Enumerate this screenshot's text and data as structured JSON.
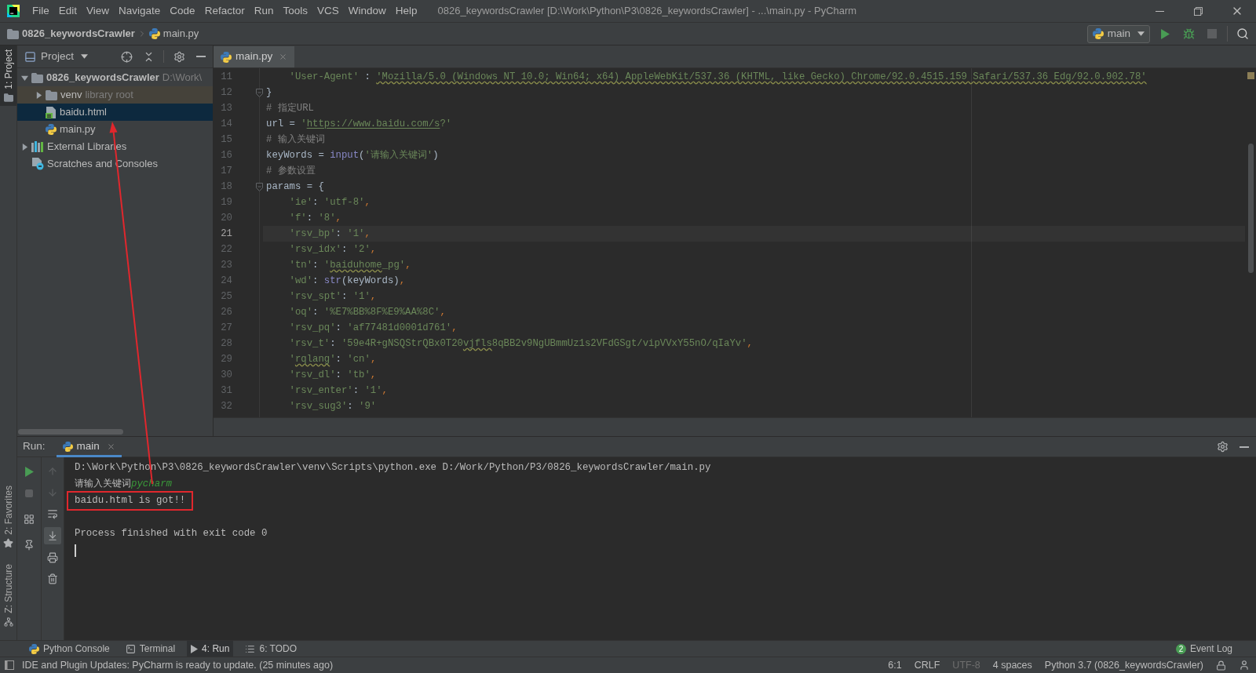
{
  "window": {
    "title": "0826_keywordsCrawler [D:\\Work\\Python\\P3\\0826_keywordsCrawler] - ...\\main.py - PyCharm"
  },
  "menu": [
    "File",
    "Edit",
    "View",
    "Navigate",
    "Code",
    "Refactor",
    "Run",
    "Tools",
    "VCS",
    "Window",
    "Help"
  ],
  "navigation": {
    "breadcrumb": [
      {
        "label": "0826_keywordsCrawler",
        "kind": "project"
      },
      {
        "label": "main.py",
        "kind": "python"
      }
    ],
    "run_config": "main",
    "stop_disabled": true
  },
  "side_stripe": [
    {
      "label": "1: Project",
      "kind": "folder",
      "selected": true
    },
    {
      "label": "2: Favorites",
      "kind": "star",
      "selected": false
    },
    {
      "label": "Z: Structure",
      "kind": "structure",
      "selected": false
    }
  ],
  "project": {
    "title": "Project",
    "tree": [
      {
        "label": "0826_keywordsCrawler",
        "hint": "D:\\Work\\",
        "kind": "project",
        "expanded": true,
        "selected": false,
        "children": [
          {
            "label": "venv",
            "hint": "library root",
            "kind": "venv",
            "expanded": false,
            "selected": false
          },
          {
            "label": "baidu.html",
            "kind": "html",
            "selected": true
          },
          {
            "label": "main.py",
            "kind": "python",
            "selected": false
          }
        ]
      },
      {
        "label": "External Libraries",
        "kind": "libraries",
        "expanded": false,
        "selected": false
      },
      {
        "label": "Scratches and Consoles",
        "kind": "scratches",
        "selected": false
      }
    ]
  },
  "editor": {
    "tabs": [
      {
        "label": "main.py",
        "selected": true
      }
    ],
    "lines": [
      {
        "number": "11",
        "current": false,
        "fold": false,
        "tokens": [
          {
            "kind": "string",
            "text": "    'User-Agent'"
          },
          {
            "kind": "plain",
            "text": " : "
          },
          {
            "kind": "flagged",
            "text": "'Mozilla/5.0 (Windows NT 10.0; Win64; x64) AppleWebKit/537.36 (KHTML, like Gecko) Chrome/92.0.4515.159 Safari/537.36 Edg/92.0.902.78'"
          }
        ]
      },
      {
        "number": "12",
        "current": false,
        "fold": true,
        "tokens": [
          {
            "kind": "plain",
            "text": "}"
          }
        ]
      },
      {
        "number": "13",
        "current": false,
        "fold": false,
        "tokens": [
          {
            "kind": "comment",
            "text": "# 指定URL"
          }
        ]
      },
      {
        "number": "14",
        "current": false,
        "fold": false,
        "tokens": [
          {
            "kind": "plain",
            "text": "url = "
          },
          {
            "kind": "string",
            "text": "'"
          },
          {
            "kind": "link",
            "text": "https://www.baidu.com/s"
          },
          {
            "kind": "string",
            "text": "?'"
          }
        ]
      },
      {
        "number": "15",
        "current": false,
        "fold": false,
        "tokens": [
          {
            "kind": "comment",
            "text": "# 输入关键词"
          }
        ]
      },
      {
        "number": "16",
        "current": false,
        "fold": false,
        "tokens": [
          {
            "kind": "plain",
            "text": "keyWords = "
          },
          {
            "kind": "builtin",
            "text": "input"
          },
          {
            "kind": "plain",
            "text": "("
          },
          {
            "kind": "string",
            "text": "'请输入关键词'"
          },
          {
            "kind": "plain",
            "text": ")"
          }
        ]
      },
      {
        "number": "17",
        "current": false,
        "fold": false,
        "tokens": [
          {
            "kind": "comment",
            "text": "# 参数设置"
          }
        ]
      },
      {
        "number": "18",
        "current": false,
        "fold": true,
        "tokens": [
          {
            "kind": "plain",
            "text": "params = {"
          }
        ]
      },
      {
        "number": "19",
        "current": false,
        "fold": false,
        "tokens": [
          {
            "kind": "string",
            "text": "    'ie'"
          },
          {
            "kind": "plain",
            "text": ": "
          },
          {
            "kind": "string",
            "text": "'utf-8'"
          },
          {
            "kind": "punct",
            "text": ","
          }
        ]
      },
      {
        "number": "20",
        "current": false,
        "fold": false,
        "tokens": [
          {
            "kind": "string",
            "text": "    'f'"
          },
          {
            "kind": "plain",
            "text": ": "
          },
          {
            "kind": "string",
            "text": "'8'"
          },
          {
            "kind": "punct",
            "text": ","
          }
        ]
      },
      {
        "number": "21",
        "current": true,
        "fold": false,
        "tokens": [
          {
            "kind": "string",
            "text": "    'rsv_bp'"
          },
          {
            "kind": "plain",
            "text": ": "
          },
          {
            "kind": "string",
            "text": "'1'"
          },
          {
            "kind": "punct",
            "text": ","
          }
        ]
      },
      {
        "number": "22",
        "current": false,
        "fold": false,
        "tokens": [
          {
            "kind": "string",
            "text": "    'rsv_idx'"
          },
          {
            "kind": "plain",
            "text": ": "
          },
          {
            "kind": "string",
            "text": "'2'"
          },
          {
            "kind": "punct",
            "text": ","
          }
        ]
      },
      {
        "number": "23",
        "current": false,
        "fold": false,
        "tokens": [
          {
            "kind": "string",
            "text": "    'tn'"
          },
          {
            "kind": "plain",
            "text": ": "
          },
          {
            "kind": "string",
            "text": "'"
          },
          {
            "kind": "flagged",
            "text": "baiduhome"
          },
          {
            "kind": "string",
            "text": "_pg'"
          },
          {
            "kind": "punct",
            "text": ","
          }
        ]
      },
      {
        "number": "24",
        "current": false,
        "fold": false,
        "tokens": [
          {
            "kind": "string",
            "text": "    'wd'"
          },
          {
            "kind": "plain",
            "text": ": "
          },
          {
            "kind": "builtin",
            "text": "str"
          },
          {
            "kind": "plain",
            "text": "(keyWords)"
          },
          {
            "kind": "punct",
            "text": ","
          }
        ]
      },
      {
        "number": "25",
        "current": false,
        "fold": false,
        "tokens": [
          {
            "kind": "string",
            "text": "    'rsv_spt'"
          },
          {
            "kind": "plain",
            "text": ": "
          },
          {
            "kind": "string",
            "text": "'1'"
          },
          {
            "kind": "punct",
            "text": ","
          }
        ]
      },
      {
        "number": "26",
        "current": false,
        "fold": false,
        "tokens": [
          {
            "kind": "string",
            "text": "    'oq'"
          },
          {
            "kind": "plain",
            "text": ": "
          },
          {
            "kind": "string",
            "text": "'%E7%BB%8F%E9%AA%8C'"
          },
          {
            "kind": "punct",
            "text": ","
          }
        ]
      },
      {
        "number": "27",
        "current": false,
        "fold": false,
        "tokens": [
          {
            "kind": "string",
            "text": "    'rsv_pq'"
          },
          {
            "kind": "plain",
            "text": ": "
          },
          {
            "kind": "string",
            "text": "'af77481d0001d761'"
          },
          {
            "kind": "punct",
            "text": ","
          }
        ]
      },
      {
        "number": "28",
        "current": false,
        "fold": false,
        "tokens": [
          {
            "kind": "string",
            "text": "    'rsv_t'"
          },
          {
            "kind": "plain",
            "text": ": "
          },
          {
            "kind": "string",
            "text": "'59e4R+gNSQStrQBx0T20"
          },
          {
            "kind": "flagged",
            "text": "vjfls"
          },
          {
            "kind": "string",
            "text": "8qBB2v9NgUBmmUz1s2VFdGSgt/vipVVxY55nO/qIaYv'"
          },
          {
            "kind": "punct",
            "text": ","
          }
        ]
      },
      {
        "number": "29",
        "current": false,
        "fold": false,
        "tokens": [
          {
            "kind": "string",
            "text": "    '"
          },
          {
            "kind": "flagged",
            "text": "rqlang"
          },
          {
            "kind": "string",
            "text": "'"
          },
          {
            "kind": "plain",
            "text": ": "
          },
          {
            "kind": "string",
            "text": "'cn'"
          },
          {
            "kind": "punct",
            "text": ","
          }
        ]
      },
      {
        "number": "30",
        "current": false,
        "fold": false,
        "tokens": [
          {
            "kind": "string",
            "text": "    'rsv_dl'"
          },
          {
            "kind": "plain",
            "text": ": "
          },
          {
            "kind": "string",
            "text": "'tb'"
          },
          {
            "kind": "punct",
            "text": ","
          }
        ]
      },
      {
        "number": "31",
        "current": false,
        "fold": false,
        "tokens": [
          {
            "kind": "string",
            "text": "    'rsv_enter'"
          },
          {
            "kind": "plain",
            "text": ": "
          },
          {
            "kind": "string",
            "text": "'1'"
          },
          {
            "kind": "punct",
            "text": ","
          }
        ]
      },
      {
        "number": "32",
        "current": false,
        "fold": false,
        "tokens": [
          {
            "kind": "string",
            "text": "    'rsv_sug3'"
          },
          {
            "kind": "plain",
            "text": ": "
          },
          {
            "kind": "string",
            "text": "'9'"
          }
        ]
      }
    ]
  },
  "run": {
    "title": "Run:",
    "tabs": [
      {
        "label": "main",
        "selected": true
      }
    ],
    "caret": true,
    "console": [
      {
        "kind": "line",
        "highlighted": false,
        "tokens": [
          {
            "kind": "output",
            "text": "D:\\Work\\Python\\P3\\0826_keywordsCrawler\\venv\\Scripts\\python.exe D:/Work/Python/P3/0826_keywordsCrawler/main.py"
          }
        ]
      },
      {
        "kind": "line",
        "highlighted": false,
        "tokens": [
          {
            "kind": "output",
            "text": "请输入关键词"
          },
          {
            "kind": "input",
            "text": "pycharm"
          }
        ]
      },
      {
        "kind": "line",
        "highlighted": true,
        "tokens": [
          {
            "kind": "output",
            "text": "baidu.html is got!!"
          }
        ]
      },
      {
        "kind": "spaced",
        "highlighted": false,
        "tokens": [
          {
            "kind": "output",
            "text": "Process finished with exit code 0"
          }
        ]
      }
    ]
  },
  "tool_tabs": [
    {
      "label": "Python Console",
      "kind": "python",
      "selected": false
    },
    {
      "label": "Terminal",
      "kind": "terminal",
      "selected": false
    },
    {
      "label": "4: Run",
      "kind": "run",
      "selected": true
    },
    {
      "label": "6: TODO",
      "kind": "todo",
      "selected": false
    }
  ],
  "event_log": {
    "label": "Event Log",
    "count": "2"
  },
  "status_bar": {
    "message": "IDE and Plugin Updates: PyCharm is ready to update. (25 minutes ago)",
    "items": [
      {
        "text": "6:1",
        "disabled": false
      },
      {
        "text": "CRLF",
        "disabled": false
      },
      {
        "text": "UTF-8",
        "disabled": true
      },
      {
        "text": "4 spaces",
        "disabled": false
      },
      {
        "text": "Python 3.7 (0826_keywordsCrawler)",
        "disabled": false
      }
    ]
  }
}
